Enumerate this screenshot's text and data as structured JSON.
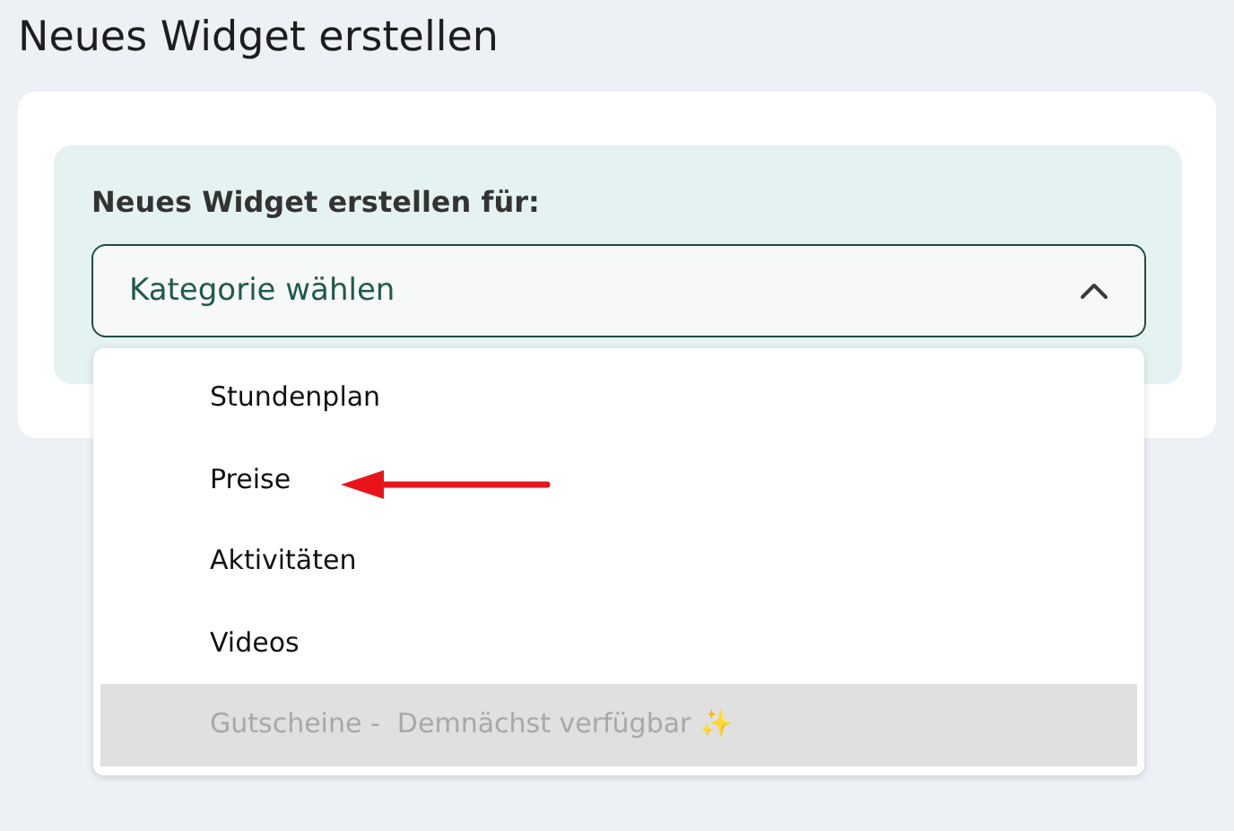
{
  "page_title": "Neues Widget erstellen",
  "form": {
    "label": "Neues Widget erstellen für:",
    "select": {
      "placeholder": "Kategorie wählen",
      "expanded": true
    },
    "options": [
      {
        "label": "Stundenplan",
        "disabled": false
      },
      {
        "label": "Preise",
        "disabled": false
      },
      {
        "label": "Aktivitäten",
        "disabled": false
      },
      {
        "label": "Videos",
        "disabled": false
      },
      {
        "label": "Gutscheine -  Demnächst verfügbar ✨",
        "disabled": true
      }
    ]
  }
}
